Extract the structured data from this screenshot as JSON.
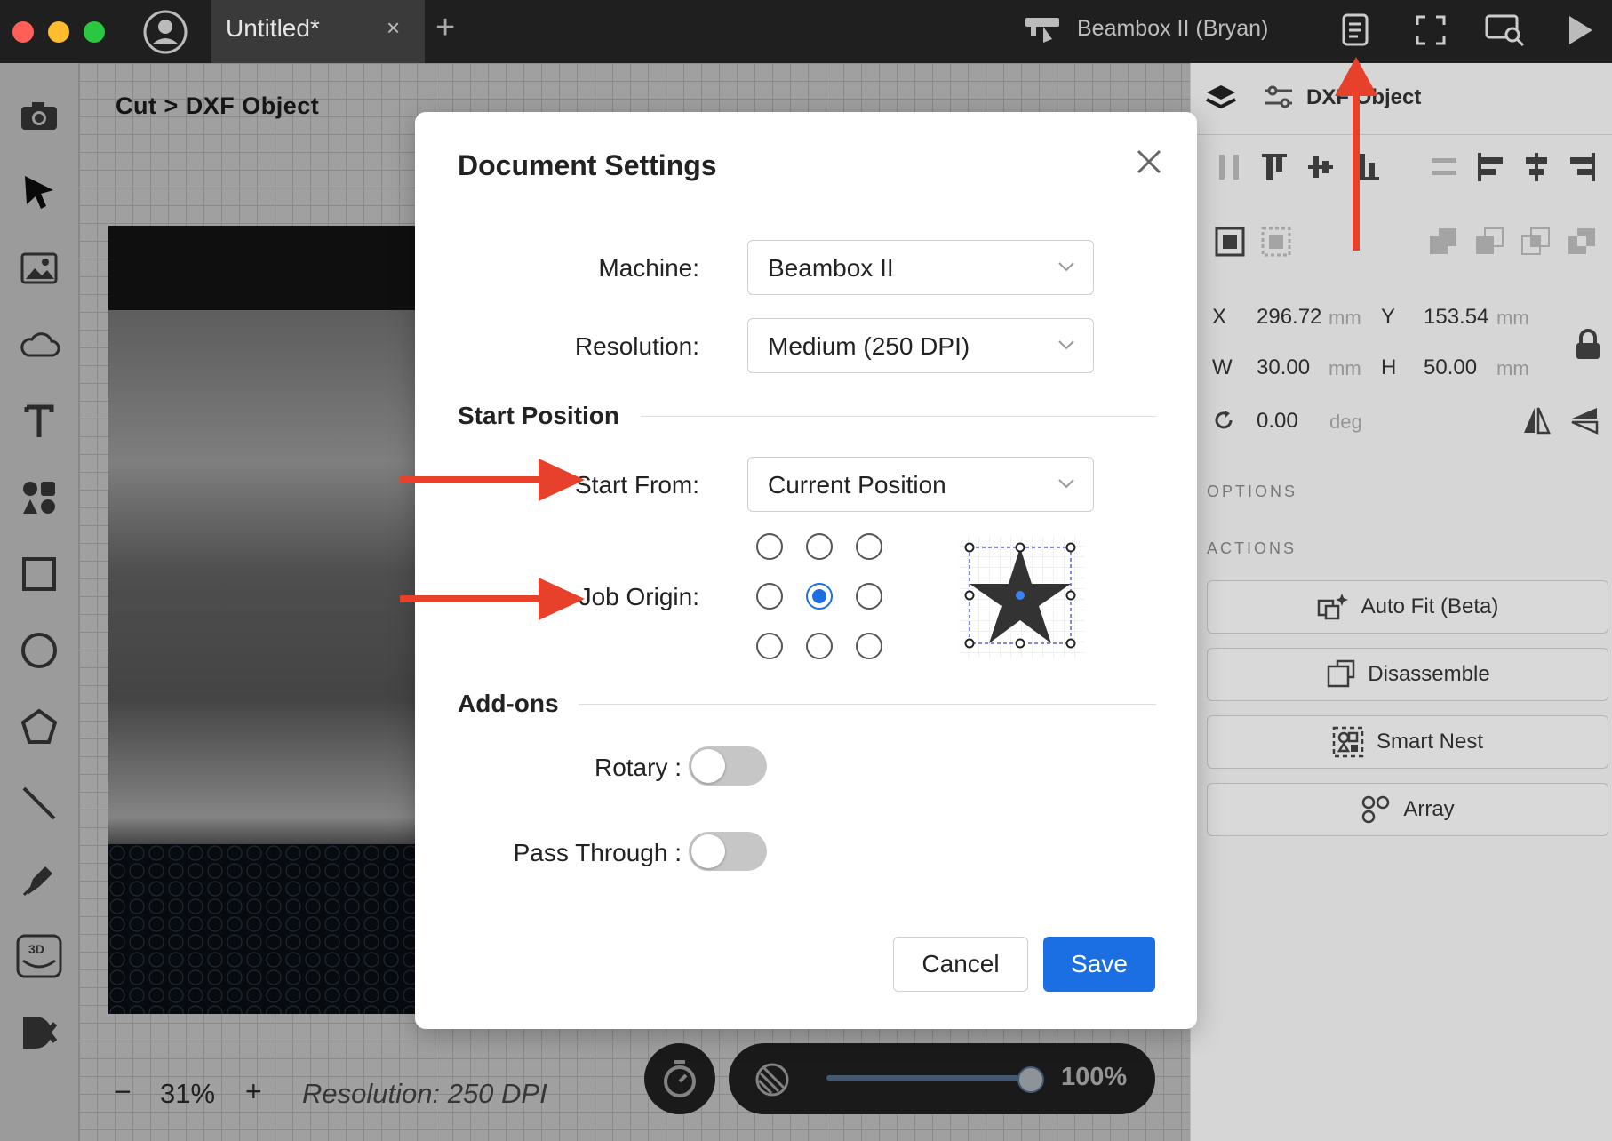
{
  "titlebar": {
    "tab_title": "Untitled*",
    "tab_close": "×",
    "tab_add": "+",
    "device_name": "Beambox II (Bryan)",
    "traffic_colors": [
      "#ff5f57",
      "#febc2e",
      "#28c840"
    ]
  },
  "canvas": {
    "breadcrumb": "Cut > DXF Object"
  },
  "bottom_bar": {
    "zoom_minus": "−",
    "zoom_value": "31%",
    "zoom_plus": "+",
    "resolution_status": "Resolution: 250 DPI",
    "opacity_value": "100%",
    "opacity_level": 1.0
  },
  "right_panel": {
    "title": "DXF Object",
    "x_label": "X",
    "x_value": "296.72",
    "x_unit": "mm",
    "y_label": "Y",
    "y_value": "153.54",
    "y_unit": "mm",
    "w_label": "W",
    "w_value": "30.00",
    "w_unit": "mm",
    "h_label": "H",
    "h_value": "50.00",
    "h_unit": "mm",
    "rotation_value": "0.00",
    "rotation_unit": "deg",
    "options_header": "OPTIONS",
    "actions_header": "ACTIONS",
    "actions": [
      "Auto Fit (Beta)",
      "Disassemble",
      "Smart Nest",
      "Array"
    ]
  },
  "modal": {
    "title": "Document Settings",
    "machine_label": "Machine:",
    "machine_value": "Beambox II",
    "resolution_label": "Resolution:",
    "resolution_value": "Medium (250 DPI)",
    "start_position_header": "Start Position",
    "start_from_label": "Start From:",
    "start_from_value": "Current Position",
    "job_origin_label": "Job Origin:",
    "job_origin_selected": "middle-center",
    "addons_header": "Add-ons",
    "rotary_label": "Rotary :",
    "rotary_on": false,
    "pass_through_label": "Pass Through :",
    "pass_through_on": false,
    "cancel_label": "Cancel",
    "save_label": "Save"
  },
  "colors": {
    "accent": "#1c6fe3",
    "annotation_arrow": "#e8412b",
    "titlebar_bg": "#1f1f1f"
  }
}
